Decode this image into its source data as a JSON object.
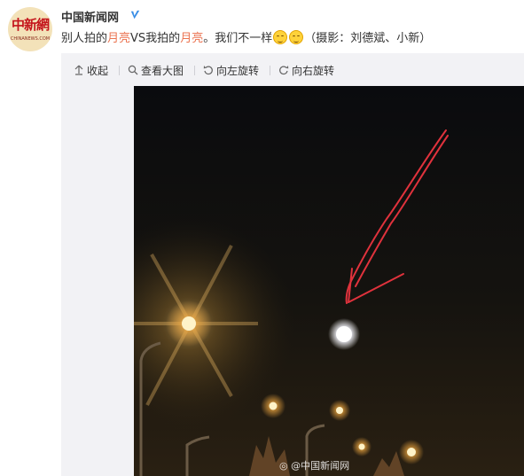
{
  "account": {
    "name": "中国新闻网",
    "avatar_text": "中新網",
    "avatar_sub": "CHINANEWS.COM",
    "verified_icon": "verified-v-icon"
  },
  "post": {
    "seg1": "别人拍的",
    "seg2": "月亮",
    "seg3": "VS我拍的",
    "seg4": "月亮",
    "seg5": "。我们不一样",
    "seg6": "（摄影：刘德斌、小新）",
    "keyword_color": "#eb7350"
  },
  "toolbar": {
    "collapse": "收起",
    "view_large": "查看大图",
    "rotate_left": "向左旋转",
    "rotate_right": "向右旋转"
  },
  "photo": {
    "watermark": "@中国新闻网"
  }
}
